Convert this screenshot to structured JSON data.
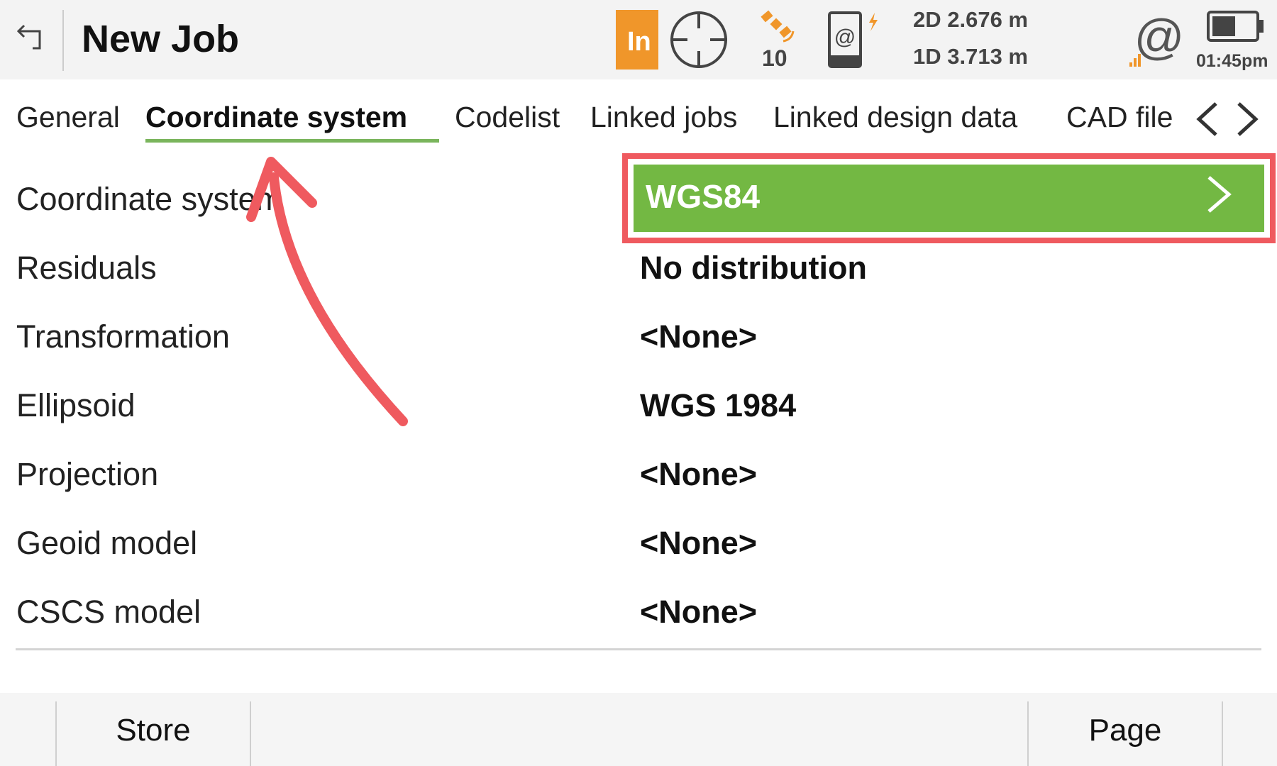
{
  "header": {
    "title": "New Job",
    "mode_badge": "In",
    "satellites": "10",
    "accuracy_2d": "2D 2.676 m",
    "accuracy_1d": "1D 3.713 m",
    "time": "01:45pm",
    "battery_level_percent": 50,
    "badge_color": "#f0962a"
  },
  "tabs": [
    {
      "label": "General"
    },
    {
      "label": "Coordinate system",
      "active": true
    },
    {
      "label": "Codelist"
    },
    {
      "label": "Linked jobs"
    },
    {
      "label": "Linked design data"
    },
    {
      "label": "CAD file"
    }
  ],
  "fields": [
    {
      "label": "Coordinate system",
      "value": "WGS84"
    },
    {
      "label": "Residuals",
      "value": "No distribution"
    },
    {
      "label": "Transformation",
      "value": "<None>"
    },
    {
      "label": "Ellipsoid",
      "value": "WGS 1984"
    },
    {
      "label": "Projection",
      "value": "<None>"
    },
    {
      "label": "Geoid model",
      "value": "<None>"
    },
    {
      "label": "CSCS model",
      "value": "<None>"
    }
  ],
  "footer": {
    "store": "Store",
    "page": "Page"
  },
  "colors": {
    "accent_green": "#73b843",
    "highlight_red": "#ef5a5f",
    "tab_underline": "#7ab55c"
  }
}
